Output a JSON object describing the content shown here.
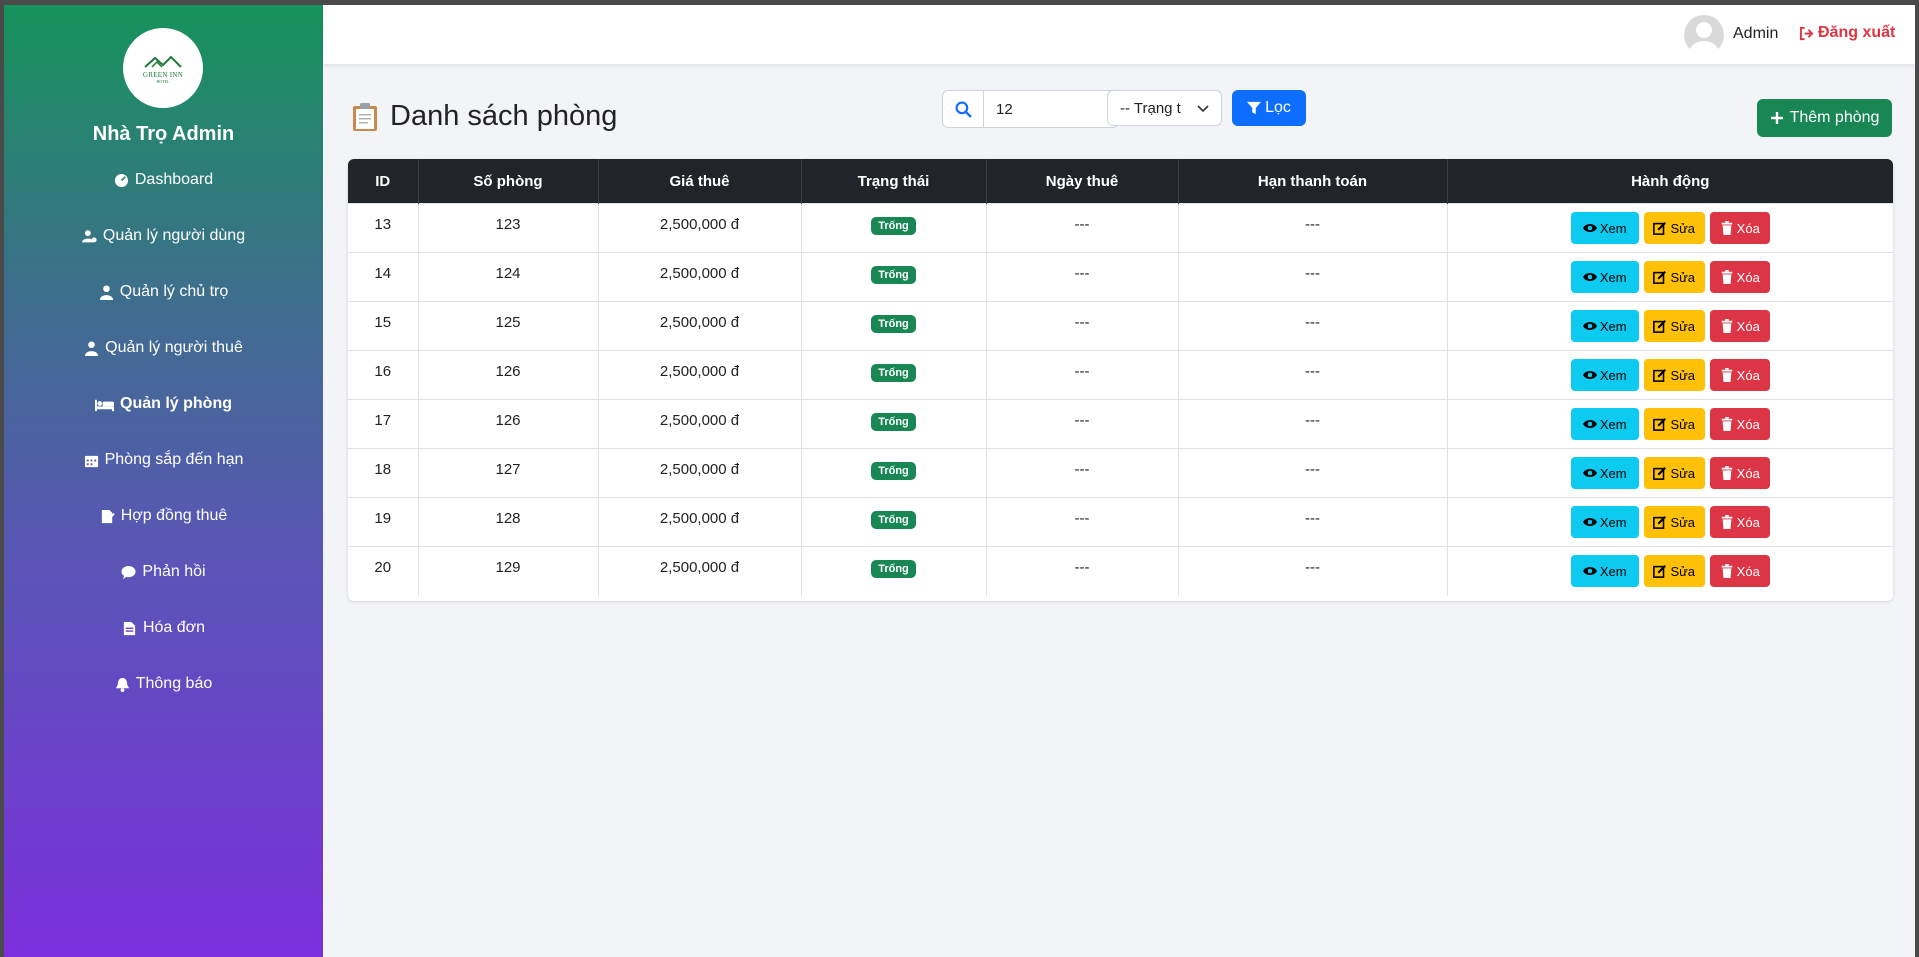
{
  "sidebar": {
    "logo_text": "GREEN INN",
    "logo_subtext": "HOTEL",
    "brand": "Nhà Trọ Admin",
    "items": [
      {
        "label": "Dashboard",
        "icon": "gauge-icon"
      },
      {
        "label": "Quản lý người dùng",
        "icon": "user-cog-icon"
      },
      {
        "label": "Quản lý chủ trọ",
        "icon": "user-tie-icon"
      },
      {
        "label": "Quản lý người thuê",
        "icon": "user-icon"
      },
      {
        "label": "Quản lý phòng",
        "icon": "bed-icon",
        "active": true
      },
      {
        "label": "Phòng sắp đến hạn",
        "icon": "calendar-icon"
      },
      {
        "label": "Hợp đồng thuê",
        "icon": "contract-icon"
      },
      {
        "label": "Phản hồi",
        "icon": "comment-icon"
      },
      {
        "label": "Hóa đơn",
        "icon": "invoice-icon"
      },
      {
        "label": "Thông báo",
        "icon": "bell-icon"
      }
    ]
  },
  "topbar": {
    "user_name": "Admin",
    "logout_label": "Đăng xuất"
  },
  "main": {
    "title": "Danh sách phòng",
    "search_value": "12",
    "status_select": "-- Trạng t",
    "filter_label": "Lọc",
    "add_label": "Thêm phòng"
  },
  "table": {
    "headers": [
      "ID",
      "Số phòng",
      "Giá thuê",
      "Trạng thái",
      "Ngày thuê",
      "Hạn thanh toán",
      "Hành động"
    ],
    "rows": [
      {
        "id": "13",
        "room": "123",
        "price": "2,500,000 đ",
        "status": "Trống",
        "rent_date": "---",
        "due": "---"
      },
      {
        "id": "14",
        "room": "124",
        "price": "2,500,000 đ",
        "status": "Trống",
        "rent_date": "---",
        "due": "---"
      },
      {
        "id": "15",
        "room": "125",
        "price": "2,500,000 đ",
        "status": "Trống",
        "rent_date": "---",
        "due": "---"
      },
      {
        "id": "16",
        "room": "126",
        "price": "2,500,000 đ",
        "status": "Trống",
        "rent_date": "---",
        "due": "---"
      },
      {
        "id": "17",
        "room": "126",
        "price": "2,500,000 đ",
        "status": "Trống",
        "rent_date": "---",
        "due": "---"
      },
      {
        "id": "18",
        "room": "127",
        "price": "2,500,000 đ",
        "status": "Trống",
        "rent_date": "---",
        "due": "---"
      },
      {
        "id": "19",
        "room": "128",
        "price": "2,500,000 đ",
        "status": "Trống",
        "rent_date": "---",
        "due": "---"
      },
      {
        "id": "20",
        "room": "129",
        "price": "2,500,000 đ",
        "status": "Trống",
        "rent_date": "---",
        "due": "---"
      }
    ],
    "action_view": "Xem",
    "action_edit": "Sửa",
    "action_delete": "Xóa"
  },
  "colors": {
    "primary": "#0d6efd",
    "success": "#198754",
    "info": "#0dcaf0",
    "warning": "#ffc107",
    "danger": "#dc3545",
    "table_header": "#212529"
  }
}
